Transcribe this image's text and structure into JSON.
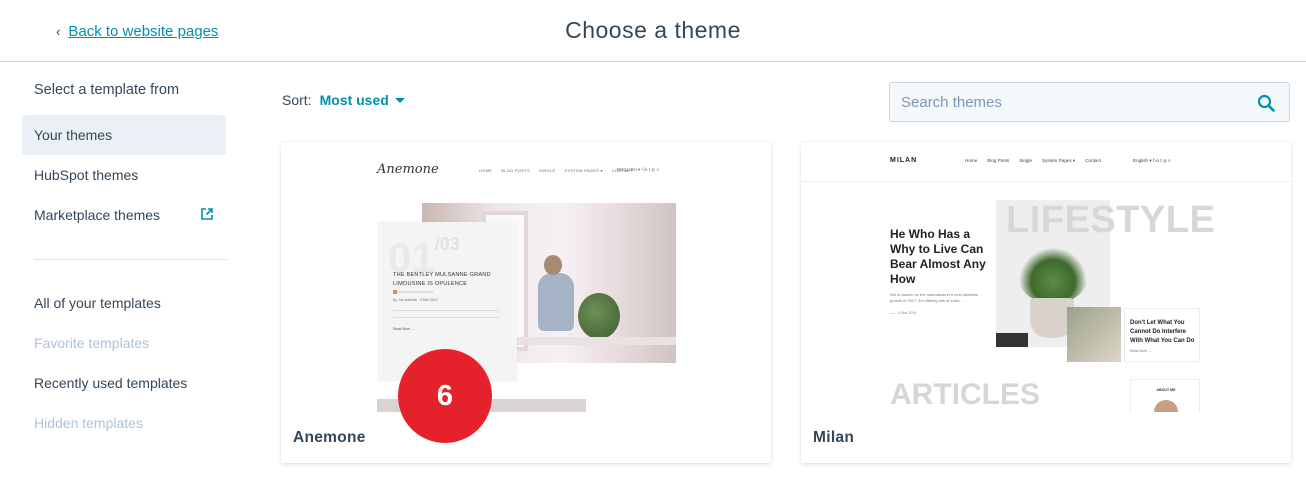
{
  "header": {
    "back_link": "Back to website pages",
    "title": "Choose a theme"
  },
  "sidebar": {
    "heading": "Select a template from",
    "source_items": [
      {
        "label": "Your themes",
        "active": true
      },
      {
        "label": "HubSpot themes"
      },
      {
        "label": "Marketplace themes",
        "icon": "external-link-icon"
      }
    ],
    "template_items": [
      {
        "label": "All of your templates"
      },
      {
        "label": "Favorite templates",
        "disabled": true
      },
      {
        "label": "Recently used templates"
      },
      {
        "label": "Hidden templates",
        "disabled": true
      }
    ]
  },
  "toolbar": {
    "sort_label": "Sort:",
    "sort_value": "Most used"
  },
  "search": {
    "placeholder": "Search themes",
    "icon": "search-icon"
  },
  "themes": [
    {
      "name": "Anemone",
      "preview": {
        "logo": "Anemone",
        "nav": [
          "HOME",
          "BLOG POSTS",
          "SINGLE",
          "SYSTEM PAGES ▾",
          "CONTACT"
        ],
        "social": "ENGLISH ▾  f  in  t  ◎  ⌕",
        "number": "01",
        "number_total": "/03",
        "headline": "THE BENTLEY MULSANNE GRAND LIMOUSINE IS OPULENCE",
        "byline": "By Joe Isabella   · 4 Mar 2019",
        "read_more": "Read More →"
      }
    },
    {
      "name": "Milan",
      "preview": {
        "logo": "MILAN",
        "nav": [
          "Home",
          "Blog Posts",
          "Single",
          "System Pages ▾",
          "Contact"
        ],
        "social": "English ▾  f  in  t  ◎  ⌕",
        "big_word": "LIFESTYLE",
        "headline": "He Who Has a Why to Live Can Bear Almost Any How",
        "sub": "Set to launch on the manufacturer's new Adelaide growth in 2017, it's offering lots of extra...",
        "date": "——  4 Mar 2019",
        "card_title": "Don't Let What You Cannot Do Interfere With What You Can Do",
        "card_link": "Read More →",
        "section_word": "ARTICLES",
        "about": "ABOUT ME"
      }
    }
  ],
  "step_badge": "6",
  "colors": {
    "accent": "#0091ae",
    "text": "#33475b",
    "badge": "#e5222c",
    "active_bg": "#eaf0f6"
  }
}
